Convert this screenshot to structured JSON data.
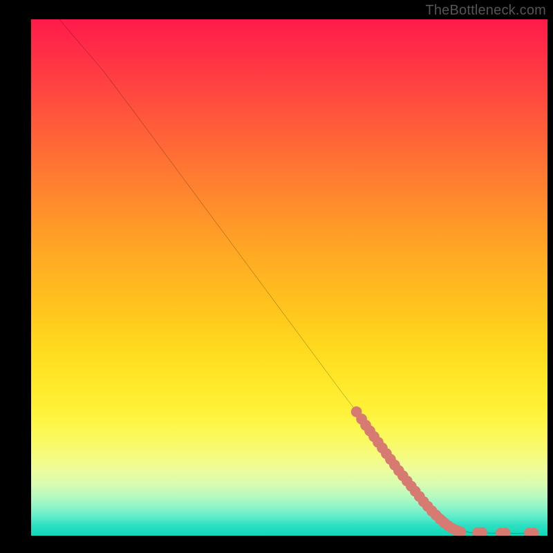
{
  "watermark": "TheBottleneck.com",
  "chart_data": {
    "type": "line",
    "title": "",
    "xlabel": "",
    "ylabel": "",
    "xlim": [
      0,
      100
    ],
    "ylim": [
      0,
      100
    ],
    "grid": false,
    "curve": [
      {
        "x": 5.5,
        "y": 100
      },
      {
        "x": 8,
        "y": 97
      },
      {
        "x": 11,
        "y": 93.5
      },
      {
        "x": 14,
        "y": 90
      },
      {
        "x": 20,
        "y": 82
      },
      {
        "x": 30,
        "y": 68.5
      },
      {
        "x": 40,
        "y": 55
      },
      {
        "x": 50,
        "y": 41.5
      },
      {
        "x": 60,
        "y": 28
      },
      {
        "x": 70,
        "y": 15
      },
      {
        "x": 78,
        "y": 5.5
      },
      {
        "x": 83,
        "y": 1.2
      },
      {
        "x": 85,
        "y": 0.6
      },
      {
        "x": 90,
        "y": 0.5
      },
      {
        "x": 95,
        "y": 0.5
      },
      {
        "x": 98,
        "y": 0.5
      }
    ],
    "dots": [
      {
        "x": 63,
        "y": 24
      },
      {
        "x": 64,
        "y": 22.6
      },
      {
        "x": 64.8,
        "y": 21.4
      },
      {
        "x": 65.6,
        "y": 20.3
      },
      {
        "x": 66.4,
        "y": 19.2
      },
      {
        "x": 67.2,
        "y": 18.1
      },
      {
        "x": 68,
        "y": 17
      },
      {
        "x": 68.8,
        "y": 15.9
      },
      {
        "x": 69.6,
        "y": 14.8
      },
      {
        "x": 70.4,
        "y": 13.7
      },
      {
        "x": 71.2,
        "y": 12.6
      },
      {
        "x": 72,
        "y": 11.6
      },
      {
        "x": 72.8,
        "y": 10.6
      },
      {
        "x": 73.6,
        "y": 9.6
      },
      {
        "x": 74.4,
        "y": 8.6
      },
      {
        "x": 75.2,
        "y": 7.6
      },
      {
        "x": 76,
        "y": 6.6
      },
      {
        "x": 76.8,
        "y": 5.7
      },
      {
        "x": 77.6,
        "y": 4.8
      },
      {
        "x": 78.4,
        "y": 4.0
      },
      {
        "x": 79.2,
        "y": 3.2
      },
      {
        "x": 80,
        "y": 2.5
      },
      {
        "x": 80.8,
        "y": 1.9
      },
      {
        "x": 81.6,
        "y": 1.4
      },
      {
        "x": 82.4,
        "y": 1.0
      },
      {
        "x": 83.2,
        "y": 0.7
      },
      {
        "x": 86.5,
        "y": 0.6
      },
      {
        "x": 87.3,
        "y": 0.6
      },
      {
        "x": 91,
        "y": 0.5
      },
      {
        "x": 91.8,
        "y": 0.5
      },
      {
        "x": 96.5,
        "y": 0.5
      },
      {
        "x": 97.3,
        "y": 0.5
      }
    ],
    "dot_color": "#d77a72",
    "line_color": "#000000"
  }
}
